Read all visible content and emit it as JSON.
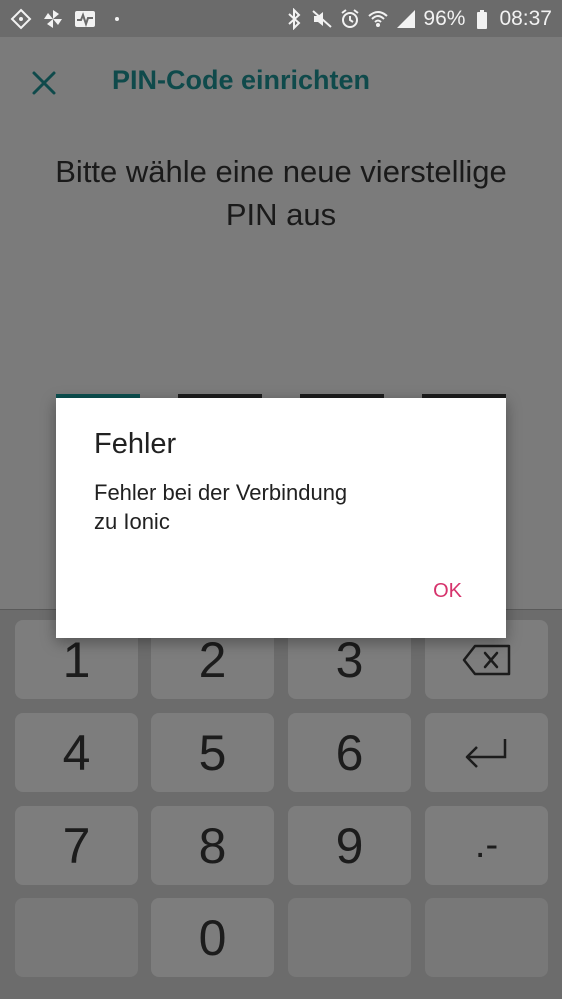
{
  "status_bar": {
    "left_icons": [
      "diamond-arrows-icon",
      "pinwheel-icon",
      "activity-icon",
      "dot-icon"
    ],
    "right_icons": [
      "bluetooth-icon",
      "mute-icon",
      "alarm-icon",
      "wifi-icon",
      "signal-icon",
      "battery-icon"
    ],
    "battery": "96%",
    "time": "08:37"
  },
  "header": {
    "title": "PIN-Code einrichten",
    "close_icon": "close-icon",
    "accent_color": "#0f4a4b"
  },
  "prompt": {
    "line1": "Bitte wähle eine neue vierstellige",
    "line2": "PIN aus"
  },
  "pin": {
    "slots": 4,
    "entered": 0
  },
  "dialog": {
    "title": "Fehler",
    "message_line1": "Fehler bei der Verbindung",
    "message_line2": "zu Ionic",
    "ok_label": "OK",
    "ok_color": "#d6336c"
  },
  "keypad": {
    "k1": "1",
    "k2": "2",
    "k3": "3",
    "k4": "4",
    "k5": "5",
    "k6": "6",
    "k7": "7",
    "k8": "8",
    "k9": "9",
    "k0": "0",
    "k_punct": ".-",
    "backspace_icon": "backspace-icon",
    "enter_icon": "enter-icon"
  }
}
